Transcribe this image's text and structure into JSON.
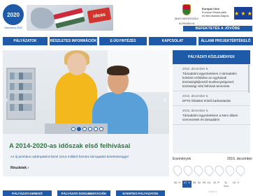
{
  "logo": {
    "badge_text": "2020",
    "caption": "Széchenyi 2020"
  },
  "government": {
    "line1": "MAGYARORSZÁG",
    "line2": "KORMÁNYA"
  },
  "eu": {
    "line1": "Európai Unió",
    "line2": "Európai Strukturális",
    "line3": "és Beruházási Alapok",
    "stars": "★ ★ ★"
  },
  "invest_banner": "BEFEKTETÉS A JÖVŐBE",
  "banner_badge": "ideas",
  "nav": {
    "items": [
      "PÁLYÁZATOK",
      "RÉSZLETES INFORMÁCIÓK",
      "E-ÜGYINTÉZÉS",
      "KAPCSOLAT",
      "ÁLLAMI PROJEKTÉRTÉKELŐ"
    ]
  },
  "hero": {
    "headline": "A 2014-2020-as időszak első felhívásai",
    "description": "Az új periódus nyitányaként közel 116,5 milliárd forintos támogatási keretösszeggel",
    "more_link": "Részletek ›",
    "slides_total": 6,
    "slide_active": 1,
    "prev_arrow": "‹",
    "next_arrow": "›"
  },
  "news": {
    "header": "PÁLYÁZATI KÖZLEMÉNYEK",
    "items": [
      {
        "date": "2016. december 6.",
        "title": "Társadalmi egyeztetésen A társadalmi kohézió erősítése az egyházak közösségfejlesztő tevékenységeivel, közösségi célú felhívás tervezete"
      },
      {
        "date": "2016. december 6.",
        "title": "EPTK felületet érintő karbantartás"
      },
      {
        "date": "2016. december 6.",
        "title": "Társadalmi egyeztetésen a Nem állami szervezetek és társadalmi"
      }
    ]
  },
  "events": {
    "label": "Események",
    "month": "2016. december",
    "days": [
      "06. H",
      "07. K",
      "08. Sz",
      "09. Cs",
      "10. P",
      "11. Szo",
      "12. V"
    ],
    "selected_day_index": 1,
    "pager": "‹  ‹‹  ››  ›"
  },
  "bottom_buttons": [
    "PÁLYÁZATI KERESŐ",
    "PÁLYÁZATI DOKUMENTÁCIÓK",
    "NYERTES PÁLYÁZATOK"
  ],
  "colors": {
    "brand_blue": "#1e5aa8",
    "headline_green": "#2a7a3c",
    "accent_yellow": "#f2b81c"
  }
}
